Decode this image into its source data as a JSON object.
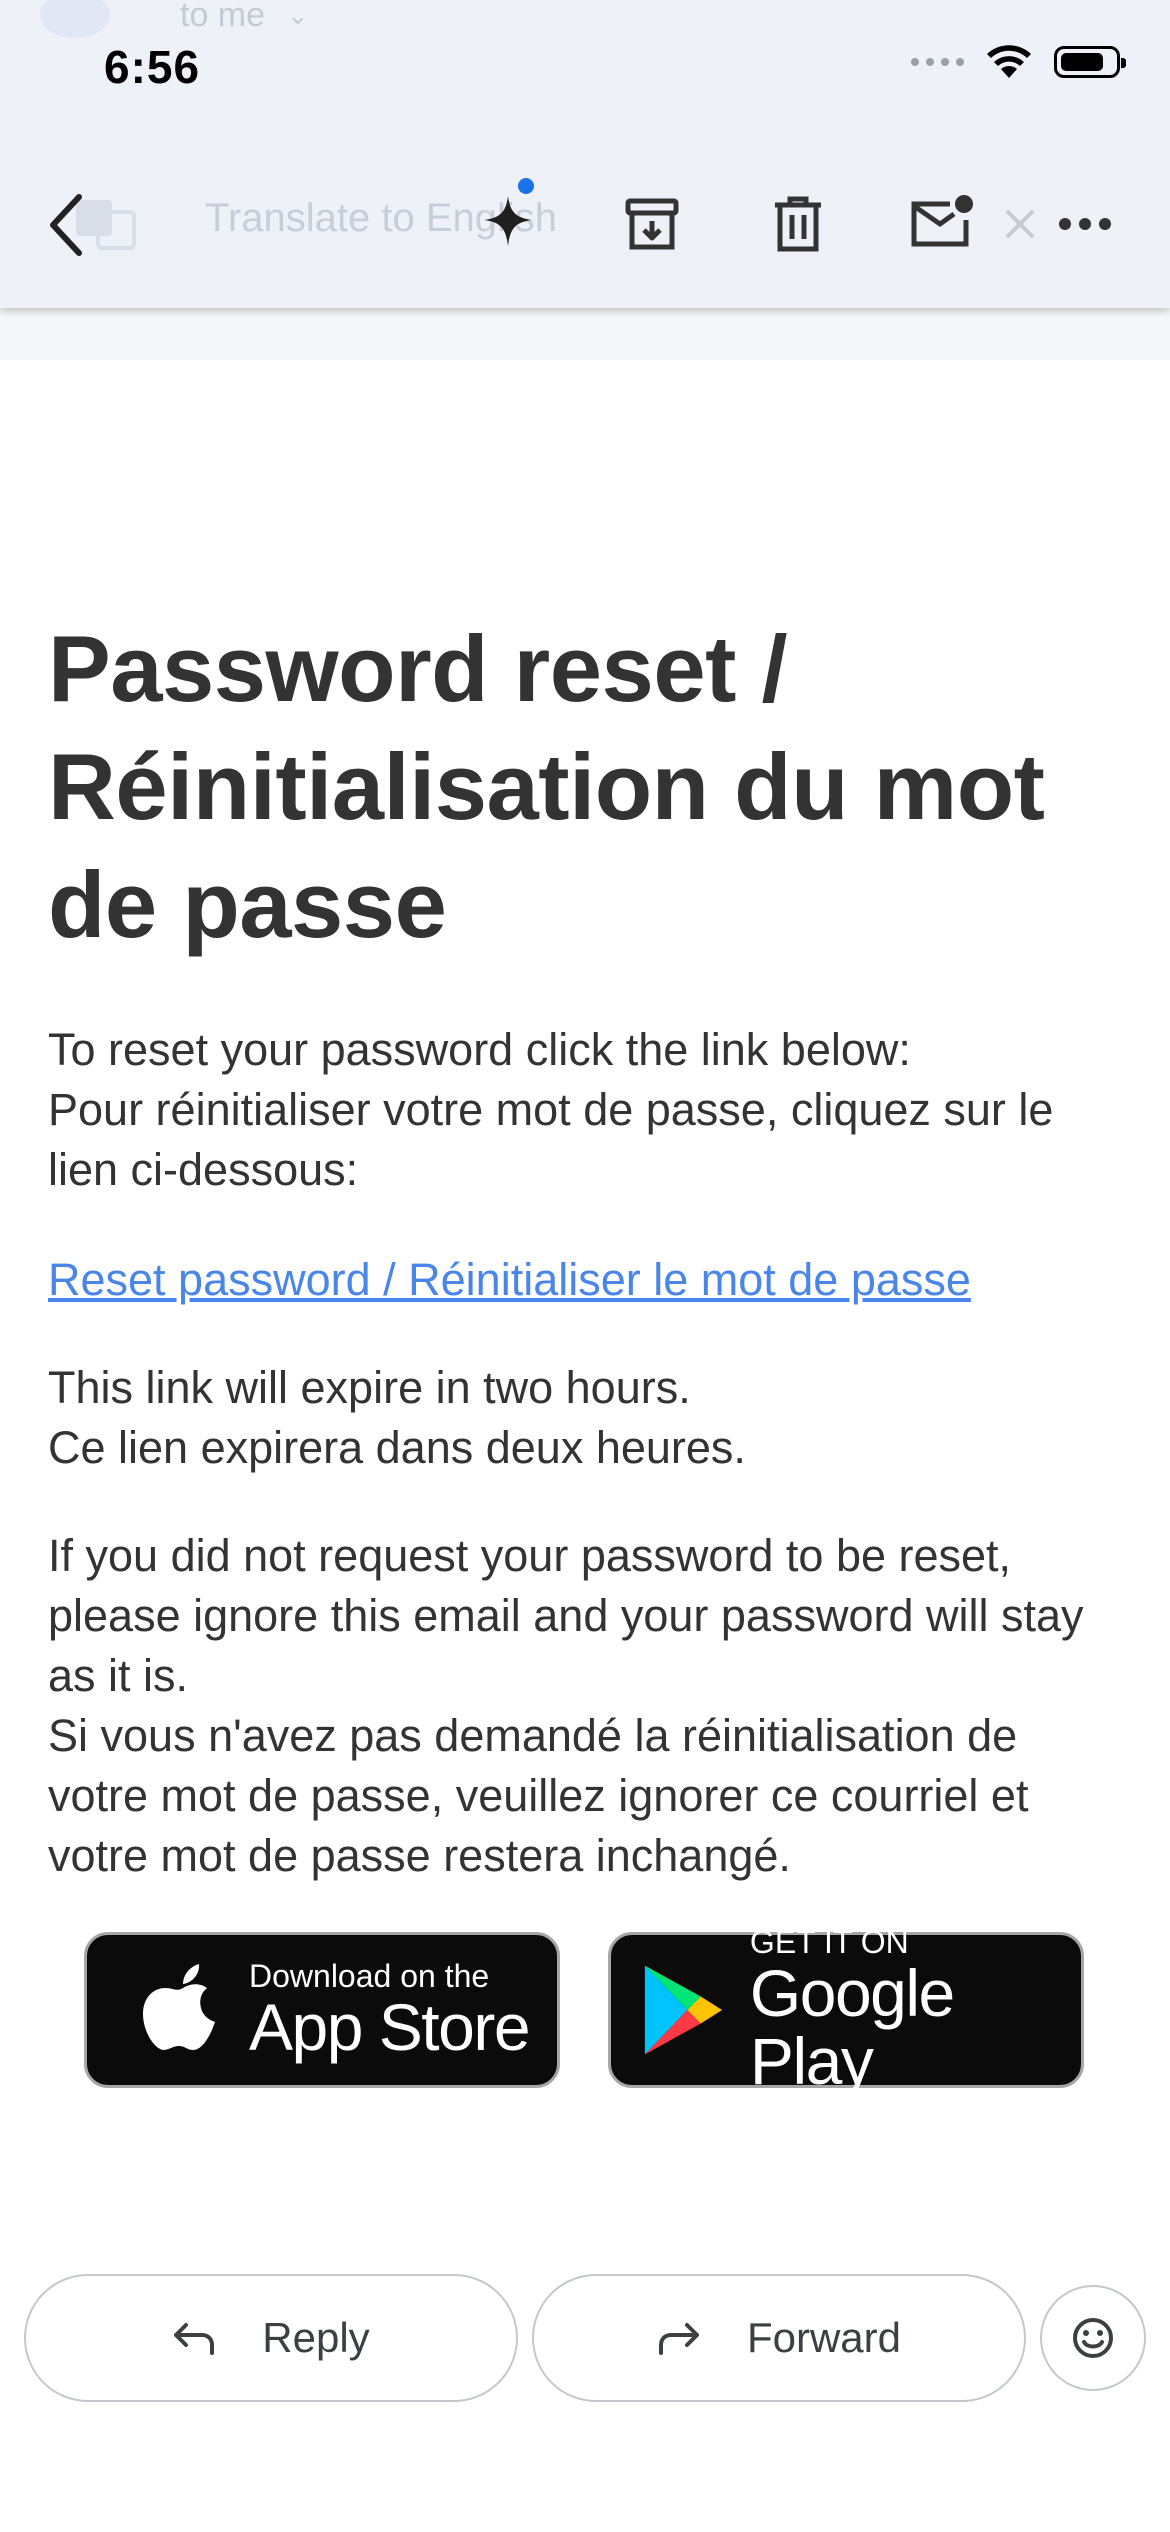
{
  "behind": {
    "recipient_text": "to me"
  },
  "status_bar": {
    "time": "6:56"
  },
  "toolbar": {
    "translate_label": "Translate to English",
    "buttons": [
      "back",
      "gemini",
      "archive",
      "delete",
      "mark-unread",
      "more"
    ]
  },
  "email": {
    "subject": "Password reset / Réinitialisation du mot de passe",
    "intro_lines": [
      "To reset your password click the link below:",
      "Pour réinitialiser votre mot de passe, cliquez sur le lien ci-dessous:"
    ],
    "reset_link": "Reset password / Réinitialiser le mot de passe",
    "expiry_lines": [
      "This link will expire in two hours.",
      "Ce lien expirera dans deux heures."
    ],
    "ignore_lines": [
      "If you did not request your password to be reset, please ignore this email and your password will stay as it is.",
      "Si vous n'avez pas demandé la réinitialisation de votre mot de passe, veuillez ignorer ce courriel et votre mot de passe restera inchangé."
    ]
  },
  "badges": {
    "app_store": {
      "small": "Download on the",
      "big": "App Store"
    },
    "google_play": {
      "small": "GET IT ON",
      "big": "Google Play"
    }
  },
  "actions": {
    "reply": "Reply",
    "forward": "Forward"
  },
  "colors": {
    "link": "#4a86e8",
    "gemini_dot": "#1a73e8",
    "toolbar_bg": "#eef1f7"
  }
}
